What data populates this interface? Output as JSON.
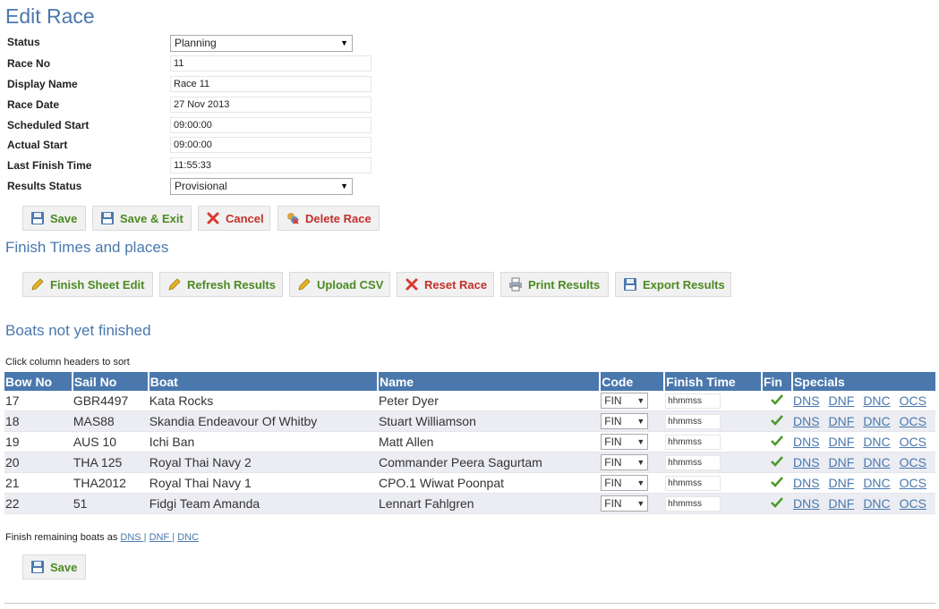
{
  "page_title": "Edit Race",
  "form": {
    "status": {
      "label": "Status",
      "value": "Planning"
    },
    "race_no": {
      "label": "Race No",
      "value": "11"
    },
    "display_name": {
      "label": "Display Name",
      "value": "Race 11"
    },
    "race_date": {
      "label": "Race Date",
      "value": "27 Nov 2013"
    },
    "scheduled_start": {
      "label": "Scheduled Start",
      "value": "09:00:00"
    },
    "actual_start": {
      "label": "Actual Start",
      "value": "09:00:00"
    },
    "last_finish": {
      "label": "Last Finish Time",
      "value": "11:55:33"
    },
    "results_status": {
      "label": "Results Status",
      "value": "Provisional"
    }
  },
  "form_buttons": {
    "save": "Save",
    "save_exit": "Save & Exit",
    "cancel": "Cancel",
    "delete": "Delete Race"
  },
  "finish_section": {
    "title": "Finish Times and places",
    "buttons": {
      "finish_sheet": "Finish Sheet Edit",
      "refresh": "Refresh Results",
      "upload": "Upload CSV",
      "reset": "Reset Race",
      "print": "Print Results",
      "export": "Export Results"
    }
  },
  "boats_section": {
    "title": "Boats not yet finished",
    "hint": "Click column headers to sort",
    "columns": [
      "Bow No",
      "Sail No",
      "Boat",
      "Name",
      "Code",
      "Finish Time",
      "Fin",
      "Specials"
    ],
    "rows": [
      {
        "bow": "17",
        "sail": "GBR4497",
        "boat": "Kata Rocks",
        "name": "Peter Dyer",
        "code": "FIN",
        "finish": "hhmmss"
      },
      {
        "bow": "18",
        "sail": "MAS88",
        "boat": "Skandia Endeavour Of Whitby",
        "name": "Stuart Williamson",
        "code": "FIN",
        "finish": "hhmmss"
      },
      {
        "bow": "19",
        "sail": "AUS 10",
        "boat": "Ichi Ban",
        "name": "Matt Allen",
        "code": "FIN",
        "finish": "hhmmss"
      },
      {
        "bow": "20",
        "sail": "THA 125",
        "boat": "Royal Thai Navy 2",
        "name": "Commander Peera Sagurtam",
        "code": "FIN",
        "finish": "hhmmss"
      },
      {
        "bow": "21",
        "sail": "THA2012",
        "boat": "Royal Thai Navy 1",
        "name": "CPO.1 Wiwat Poonpat",
        "code": "FIN",
        "finish": "hhmmss"
      },
      {
        "bow": "22",
        "sail": "51",
        "boat": "Fidgi Team Amanda",
        "name": "Lennart Fahlgren",
        "code": "FIN",
        "finish": "hhmmss"
      }
    ],
    "specials": [
      "DNS",
      "DNF",
      "DNC",
      "OCS"
    ],
    "remaining": {
      "text": "Finish remaining boats as",
      "dns": "DNS |",
      "dnf": "DNF |",
      "dnc": "DNC"
    },
    "save": "Save"
  },
  "icons": {
    "save": "floppy-disk-icon",
    "cancel": "red-x-icon",
    "delete": "delete-race-icon",
    "edit": "pencil-icon",
    "print": "printer-icon",
    "fin": "check-icon"
  },
  "colors": {
    "accent": "#4a78ad",
    "green": "#4c8a23",
    "red": "#c5302a",
    "button_bg": "#f1f1f1",
    "row_alt": "#ecedf3"
  }
}
